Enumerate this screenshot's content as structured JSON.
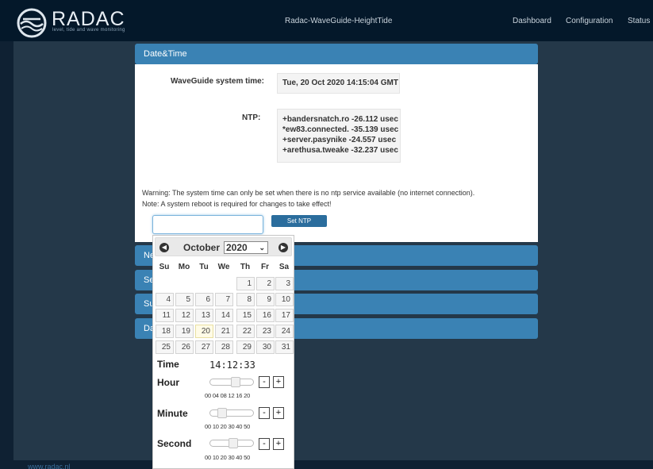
{
  "header": {
    "brand": "RADAC",
    "tagline": "level, tide and wave monitoring",
    "app_title": "Radac-WaveGuide-HeightTide",
    "nav": [
      "Dashboard",
      "Configuration",
      "Status"
    ]
  },
  "footer": {
    "link": "www.radac.nl"
  },
  "datetime_panel": {
    "title": "Date&Time",
    "system_time_label": "WaveGuide system time:",
    "system_time_value": "Tue, 20 Oct 2020 14:15:04 GMT",
    "ntp_label": "NTP:",
    "ntp_lines": [
      "+bandersnatch.ro -26.112 usec",
      "*ew83.connected. -35.139 usec",
      "+server.pasynike  -24.557 usec",
      "+arethusa.tweake -32.237 usec"
    ],
    "warning": "Warning: The system time can only be set when there is no ntp service available (no internet connection).",
    "note": "Note: A system reboot is required for changes to take effect!",
    "set_button": "Set NTP"
  },
  "collapsed_panels": [
    "Ne",
    "Se",
    "Su",
    "Da"
  ],
  "datepicker": {
    "prev_icon": "◀",
    "next_icon": "▶",
    "month": "October",
    "year": "2020",
    "weekdays": [
      "Su",
      "Mo",
      "Tu",
      "We",
      "Th",
      "Fr",
      "Sa"
    ],
    "weeks": [
      [
        "",
        "",
        "",
        "",
        "1",
        "2",
        "3"
      ],
      [
        "4",
        "5",
        "6",
        "7",
        "8",
        "9",
        "10"
      ],
      [
        "11",
        "12",
        "13",
        "14",
        "15",
        "16",
        "17"
      ],
      [
        "18",
        "19",
        "20",
        "21",
        "22",
        "23",
        "24"
      ],
      [
        "25",
        "26",
        "27",
        "28",
        "29",
        "30",
        "31"
      ]
    ],
    "today": "20",
    "time_label": "Time",
    "time_value": "14:12:33",
    "hour_label": "Hour",
    "hour_ticks": "00 04 08 12 16 20",
    "hour_value": 14,
    "hour_max": 23,
    "minute_label": "Minute",
    "minute_ticks": "00 10 20 30 40 50",
    "minute_value": 12,
    "minute_max": 59,
    "second_label": "Second",
    "second_ticks": "00 10 20 30 40 50",
    "second_value": 33,
    "second_max": 59,
    "minus": "-",
    "plus": "+"
  }
}
